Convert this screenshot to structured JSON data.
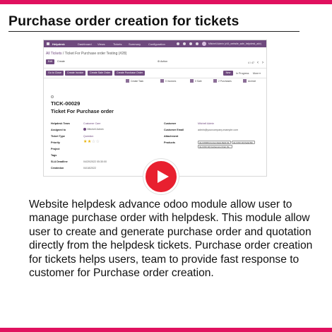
{
  "page": {
    "title": "Purchase order creation for tickets",
    "description": "Website helpdesk advance odoo module allow user to manage purchase order with helpdesk. This module allow user to create and generate purchase order and quotation directly from the helpdesk tickets. Purchase order creation for tickets helps users, team to provide fast response to customer for Purchase order creation.",
    "accent_color": "#e0115f"
  },
  "screenshot": {
    "navbar": {
      "app": "Helpdesk",
      "menus": [
        "Dashboard",
        "Views",
        "Tickets",
        "Summary",
        "Configuration"
      ],
      "user": "Mitchell Admin (v16_website_sale_helpdesk_adv)",
      "color": "#6f4a7e"
    },
    "breadcrumb": {
      "parent": "All Tickets",
      "current": "/ Ticket For Purchase order Testing (#28)"
    },
    "buttons": {
      "edit": "Edit",
      "create": "Create",
      "action": "⚙ Action"
    },
    "pager": {
      "text": "4 / 47"
    },
    "header_buttons": [
      "Go to Close",
      "Create Invoice",
      "Create Sale Order",
      "Create Purchase Order"
    ],
    "stages": {
      "active": "New",
      "others": [
        "In Progress",
        "More ▾"
      ]
    },
    "smart_buttons": [
      {
        "label": "Create Task",
        "icon": "task-icon"
      },
      {
        "label": "0 Invoices",
        "icon": "invoice-icon"
      },
      {
        "label": "0 Sale",
        "icon": "sale-icon"
      },
      {
        "label": "2 Purchases",
        "icon": "purchase-icon"
      },
      {
        "label": "Archive",
        "icon": "archive-icon"
      }
    ],
    "ticket": {
      "number": "TICK-00029",
      "name": "Ticket For Purchase order"
    },
    "left_fields": [
      {
        "label": "Helpdesk Team",
        "value": "Customer Care"
      },
      {
        "label": "Assigned to",
        "value": "Mitchell Admin"
      },
      {
        "label": "Ticket Type",
        "value": "Question"
      },
      {
        "label": "Priority",
        "value": ""
      },
      {
        "label": "Project",
        "value": ""
      },
      {
        "label": "Tags",
        "value": ""
      },
      {
        "label": "SLA Deadline",
        "value": "04/20/2022 05:30:00"
      },
      {
        "label": "Createdon",
        "value": "04/18/2022"
      }
    ],
    "priority_stars": {
      "filled": 2,
      "total": 4
    },
    "right_fields": [
      {
        "label": "Customer",
        "value": "Mitchell Admin"
      },
      {
        "label": "Customer Email",
        "value": "admin@yourcompany.example.com"
      },
      {
        "label": "Attachment",
        "value": ""
      },
      {
        "label": "Products",
        "value": ""
      }
    ],
    "product_tags": [
      "[E-COM06] Corner Desk Right Sit",
      "[E-COM 10] Pedal Bin",
      "[E-COM 10] Conference Chair (St..."
    ]
  }
}
